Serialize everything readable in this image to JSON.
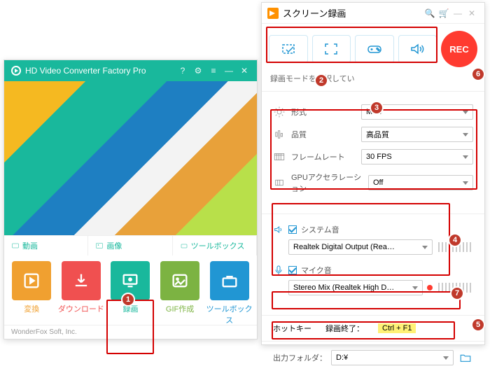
{
  "left": {
    "title": "HD Video Converter Factory Pro",
    "tabs": [
      "動画",
      "画像",
      "ツールボックス"
    ],
    "buttons": [
      {
        "label": "変換"
      },
      {
        "label": "ダウンロード"
      },
      {
        "label": "録画"
      },
      {
        "label": "GIF作成"
      },
      {
        "label": "ツールボックス"
      }
    ],
    "footer": "WonderFox Soft, Inc."
  },
  "right": {
    "title": "スクリーン録画",
    "rec": "REC",
    "mode_hint": "録画モードを選択してい",
    "format": {
      "label": "形式",
      "value": "MP4"
    },
    "quality": {
      "label": "品質",
      "value": "高品質"
    },
    "fps": {
      "label": "フレームレート",
      "value": "30 FPS"
    },
    "gpu": {
      "label": "GPUアクセラレーション",
      "value": "Off"
    },
    "sys_audio": {
      "label": "システム音",
      "value": "Realtek Digital Output (Rea…"
    },
    "mic_audio": {
      "label": "マイク音",
      "value": "Stereo Mix (Realtek High D…"
    },
    "hotkey_label": "ホットキー",
    "hotkey_stop_label": "録画終了：",
    "hotkey_stop_value": "Ctrl + F1",
    "output_label": "出力フォルダ：",
    "output_value": "D:¥"
  },
  "annotations": [
    "1",
    "2",
    "3",
    "4",
    "5",
    "6",
    "7"
  ]
}
